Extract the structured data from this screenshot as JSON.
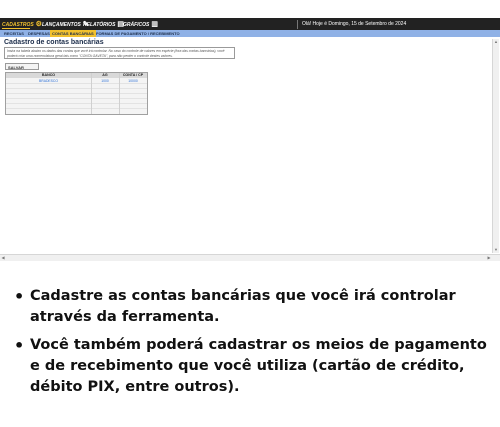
{
  "topbar": {
    "menu": [
      {
        "label": "CADASTROS",
        "icon": "gear-icon",
        "glyph": "⚙"
      },
      {
        "label": "LANÇAMENTOS",
        "icon": "pencil-icon",
        "glyph": "✎"
      },
      {
        "label": "RELATÓRIOS",
        "icon": "report-icon",
        "glyph": "▤"
      },
      {
        "label": "GRÁFICOS",
        "icon": "bar-chart-icon",
        "glyph": "▥"
      }
    ],
    "date": "Olá! Hoje é Domingo, 15 de Setembro de 2024"
  },
  "subnav": {
    "items": [
      "RECEITAS",
      "DESPESAS",
      "CONTAS BANCÁRIAS",
      "FORMAS DE PAGAMENTO / RECEBIMENTO"
    ]
  },
  "page": {
    "title": "Cadastro de contas bancárias",
    "instructions": "Insira na tabela abaixo os dados das contas que você irá controlar. No caso do controle de valores em espécie (fora das contas bancárias), você poderá criar uma nomenclatura geral tais como \"CONTA GAVETA\", para não perder o controle destes valores.",
    "save_label": "SALVAR"
  },
  "table": {
    "headers": [
      "BANCO",
      "AG",
      "CONTA / CP"
    ],
    "rows": [
      [
        "BRADESCO",
        "1000",
        "10000"
      ]
    ]
  },
  "bullets": [
    "Cadastre as contas bancárias que você irá controlar através da ferramenta.",
    "Você também poderá cadastrar os meios de pagamento e de recebimento que você utiliza (cartão de crédito, débito PIX, entre outros)."
  ],
  "colors": {
    "accent": "#f2c12e",
    "subnav": "#8fb1e6",
    "topbar": "#222222",
    "link": "#2b6fd6"
  }
}
